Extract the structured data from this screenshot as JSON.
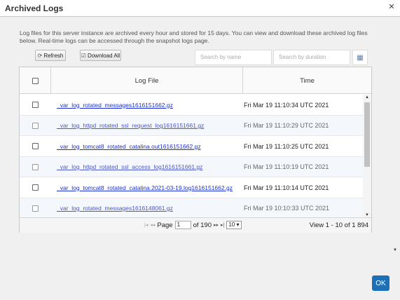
{
  "dialog": {
    "title": "Archived Logs"
  },
  "description": "Log files for this server instance are archived every hour and stored for 15 days. You can view and download these archived log files below. Real-time logs can be accessed through the snapshot logs page.",
  "toolbar": {
    "refresh_label": "Refresh",
    "download_all_label": "Download All"
  },
  "search": {
    "name_placeholder": "Search by name",
    "duration_placeholder": "Search by duration"
  },
  "grid": {
    "columns": [
      "Log File",
      "Time"
    ],
    "rows": [
      {
        "file": "_var_log_rotated_messages1616151662.gz",
        "time": "Fri Mar 19 11:10:34 UTC 2021"
      },
      {
        "file": "_var_log_httpd_rotated_ssl_request_log1616151661.gz",
        "time": "Fri Mar 19 11:10:29 UTC 2021"
      },
      {
        "file": "_var_log_tomcat8_rotated_catalina.out1616151662.gz",
        "time": "Fri Mar 19 11:10:25 UTC 2021"
      },
      {
        "file": "_var_log_httpd_rotated_ssl_access_log1616151661.gz",
        "time": "Fri Mar 19 11:10:19 UTC 2021"
      },
      {
        "file": "_var_log_tomcat8_rotated_catalina.2021-03-19.log1616151662.gz",
        "time": "Fri Mar 19 11:10:14 UTC 2021"
      },
      {
        "file": "_var_log_rotated_messages1616148061.gz",
        "time": "Fri Mar 19 10:10:33 UTC 2021"
      }
    ]
  },
  "pager": {
    "page_label": "Page",
    "page_value": "1",
    "of_label": "of 190",
    "page_size": "10",
    "view_text": "View 1 - 10 of 1 894"
  },
  "footer": {
    "ok_label": "OK"
  }
}
